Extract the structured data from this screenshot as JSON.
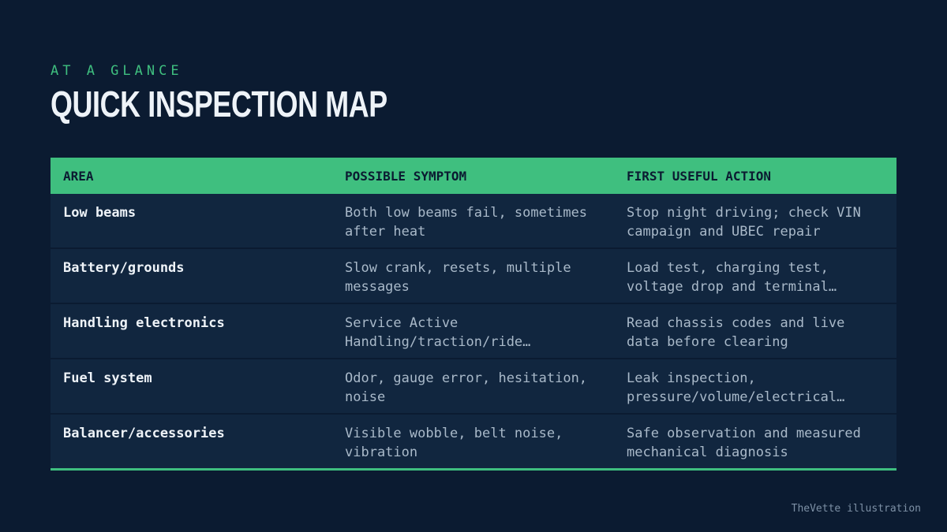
{
  "header": {
    "eyebrow": "AT A GLANCE",
    "title": "QUICK INSPECTION MAP"
  },
  "table": {
    "columns": [
      "AREA",
      "POSSIBLE SYMPTOM",
      "FIRST USEFUL ACTION"
    ],
    "rows": [
      [
        "Low beams",
        "Both low beams fail, sometimes after heat",
        "Stop night driving; check VIN campaign and UBEC repair"
      ],
      [
        "Battery/grounds",
        "Slow crank, resets, multiple messages",
        "Load test, charging test, voltage drop and terminal…"
      ],
      [
        "Handling electronics",
        "Service Active Handling/traction/ride…",
        "Read chassis codes and live data before clearing"
      ],
      [
        "Fuel system",
        "Odor, gauge error, hesitation, noise",
        "Leak inspection, pressure/volume/electrical…"
      ],
      [
        "Balancer/accessories",
        "Visible wobble, belt noise, vibration",
        "Safe observation and measured mechanical diagnosis"
      ]
    ]
  },
  "footer": {
    "credit": "TheVette illustration"
  },
  "colors": {
    "background": "#0b1b31",
    "accent": "#3fbf7f",
    "row": "#11263f"
  }
}
